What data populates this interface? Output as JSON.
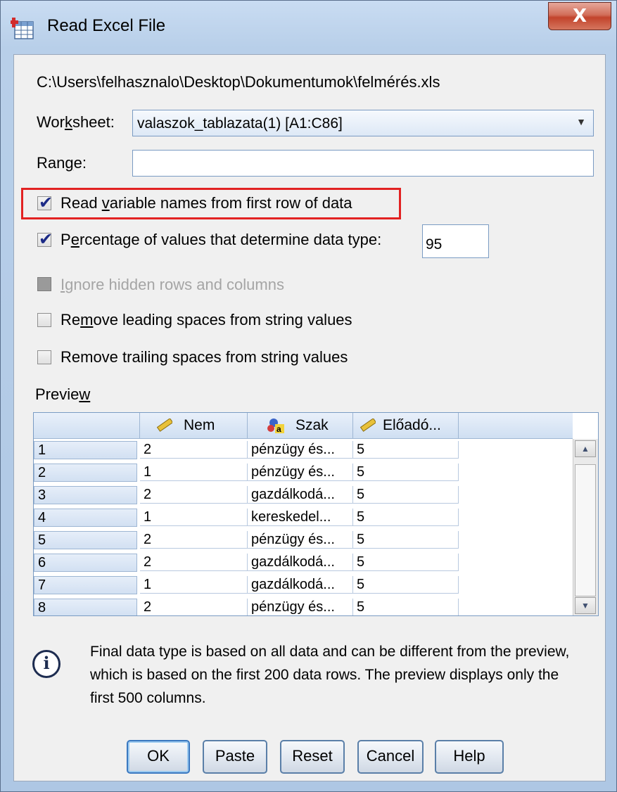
{
  "window": {
    "title": "Read Excel File",
    "close_label": "X"
  },
  "file_path": "C:\\Users\\felhasznalo\\Desktop\\Dokumentumok\\felmérés.xls",
  "worksheet": {
    "label": "Worksheet:",
    "value": "valaszok_tablazata(1) [A1:C86]"
  },
  "range": {
    "label": "Range:",
    "value": ""
  },
  "options": {
    "read_var_names": {
      "label": "Read variable names from first row of data",
      "checked": true
    },
    "percentage": {
      "label": "Percentage of values that determine data type:",
      "checked": true,
      "value": "95"
    },
    "ignore_hidden": {
      "label": "Ignore hidden rows and columns",
      "checked": false,
      "disabled": true
    },
    "remove_leading": {
      "label": "Remove leading spaces from string values",
      "checked": false
    },
    "remove_trailing": {
      "label": "Remove trailing spaces from string values",
      "checked": false
    }
  },
  "preview": {
    "label": "Preview",
    "columns": [
      {
        "name": "Nem",
        "icon": "ruler-icon"
      },
      {
        "name": "Szak",
        "icon": "nominal-icon"
      },
      {
        "name": "Előadó...",
        "icon": "ruler-icon"
      }
    ],
    "rows": [
      [
        "1",
        "2",
        "pénzügy és...",
        "5"
      ],
      [
        "2",
        "1",
        "pénzügy és...",
        "5"
      ],
      [
        "3",
        "2",
        "gazdálkodá...",
        "5"
      ],
      [
        "4",
        "1",
        "kereskedel...",
        "5"
      ],
      [
        "5",
        "2",
        "pénzügy és...",
        "5"
      ],
      [
        "6",
        "2",
        "gazdálkodá...",
        "5"
      ],
      [
        "7",
        "1",
        "gazdálkodá...",
        "5"
      ],
      [
        "8",
        "2",
        "pénzügy és...",
        "5"
      ]
    ]
  },
  "info_text": "Final data type is based on all data and can be different from the preview, which is based on the first 200 data rows. The preview displays only the first 500 columns.",
  "buttons": {
    "ok": "OK",
    "paste": "Paste",
    "reset": "Reset",
    "cancel": "Cancel",
    "help": "Help"
  },
  "colors": {
    "highlight": "#e22222",
    "check": "#1b2a86"
  }
}
